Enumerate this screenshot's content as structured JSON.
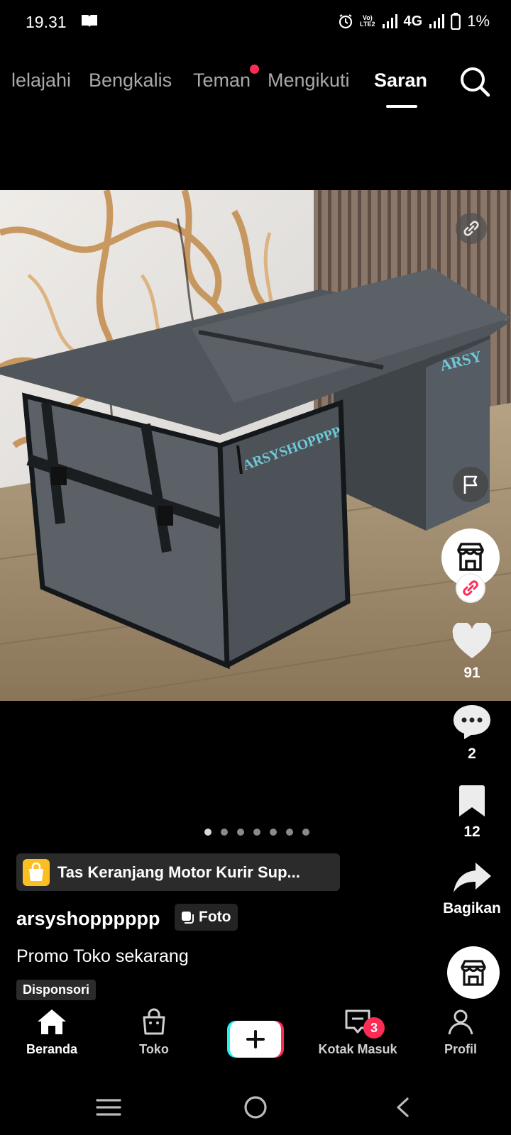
{
  "status_bar": {
    "time": "19.31",
    "network": "4G",
    "volte": "Vo) LTE2",
    "battery": "1%"
  },
  "top_nav": {
    "tabs": [
      {
        "label": "lelajahi",
        "active": false
      },
      {
        "label": "Bengkalis",
        "active": false
      },
      {
        "label": "Teman",
        "active": false,
        "notification_dot": true
      },
      {
        "label": "Mengikuti",
        "active": false
      },
      {
        "label": "Saran",
        "active": true
      }
    ],
    "search_icon": "search-icon"
  },
  "media": {
    "brand_text_front": "ARSYSHOPPPPP",
    "brand_text_side": "ARSY",
    "carousel_count": 7,
    "carousel_active": 0
  },
  "actions": {
    "likes": "91",
    "comments": "2",
    "saves": "12",
    "share_label": "Bagikan"
  },
  "post": {
    "product_title": "Tas Keranjang Motor Kurir Sup...",
    "username": "arsyshopppppp",
    "type_badge": "Foto",
    "caption": "Promo Toko sekarang",
    "sponsored_label": "Disponsori"
  },
  "bottom_nav": {
    "items": [
      {
        "label": "Beranda",
        "icon": "home-icon",
        "active": true
      },
      {
        "label": "Toko",
        "icon": "shop-bag-icon",
        "active": false
      },
      {
        "label": "",
        "icon": "plus-icon",
        "active": false
      },
      {
        "label": "Kotak Masuk",
        "icon": "inbox-icon",
        "active": false,
        "badge": "3"
      },
      {
        "label": "Profil",
        "icon": "profile-icon",
        "active": false
      }
    ]
  },
  "colors": {
    "accent_red": "#fe2c55",
    "cyan": "#25f4ee",
    "product_icon": "#fbbf24"
  }
}
